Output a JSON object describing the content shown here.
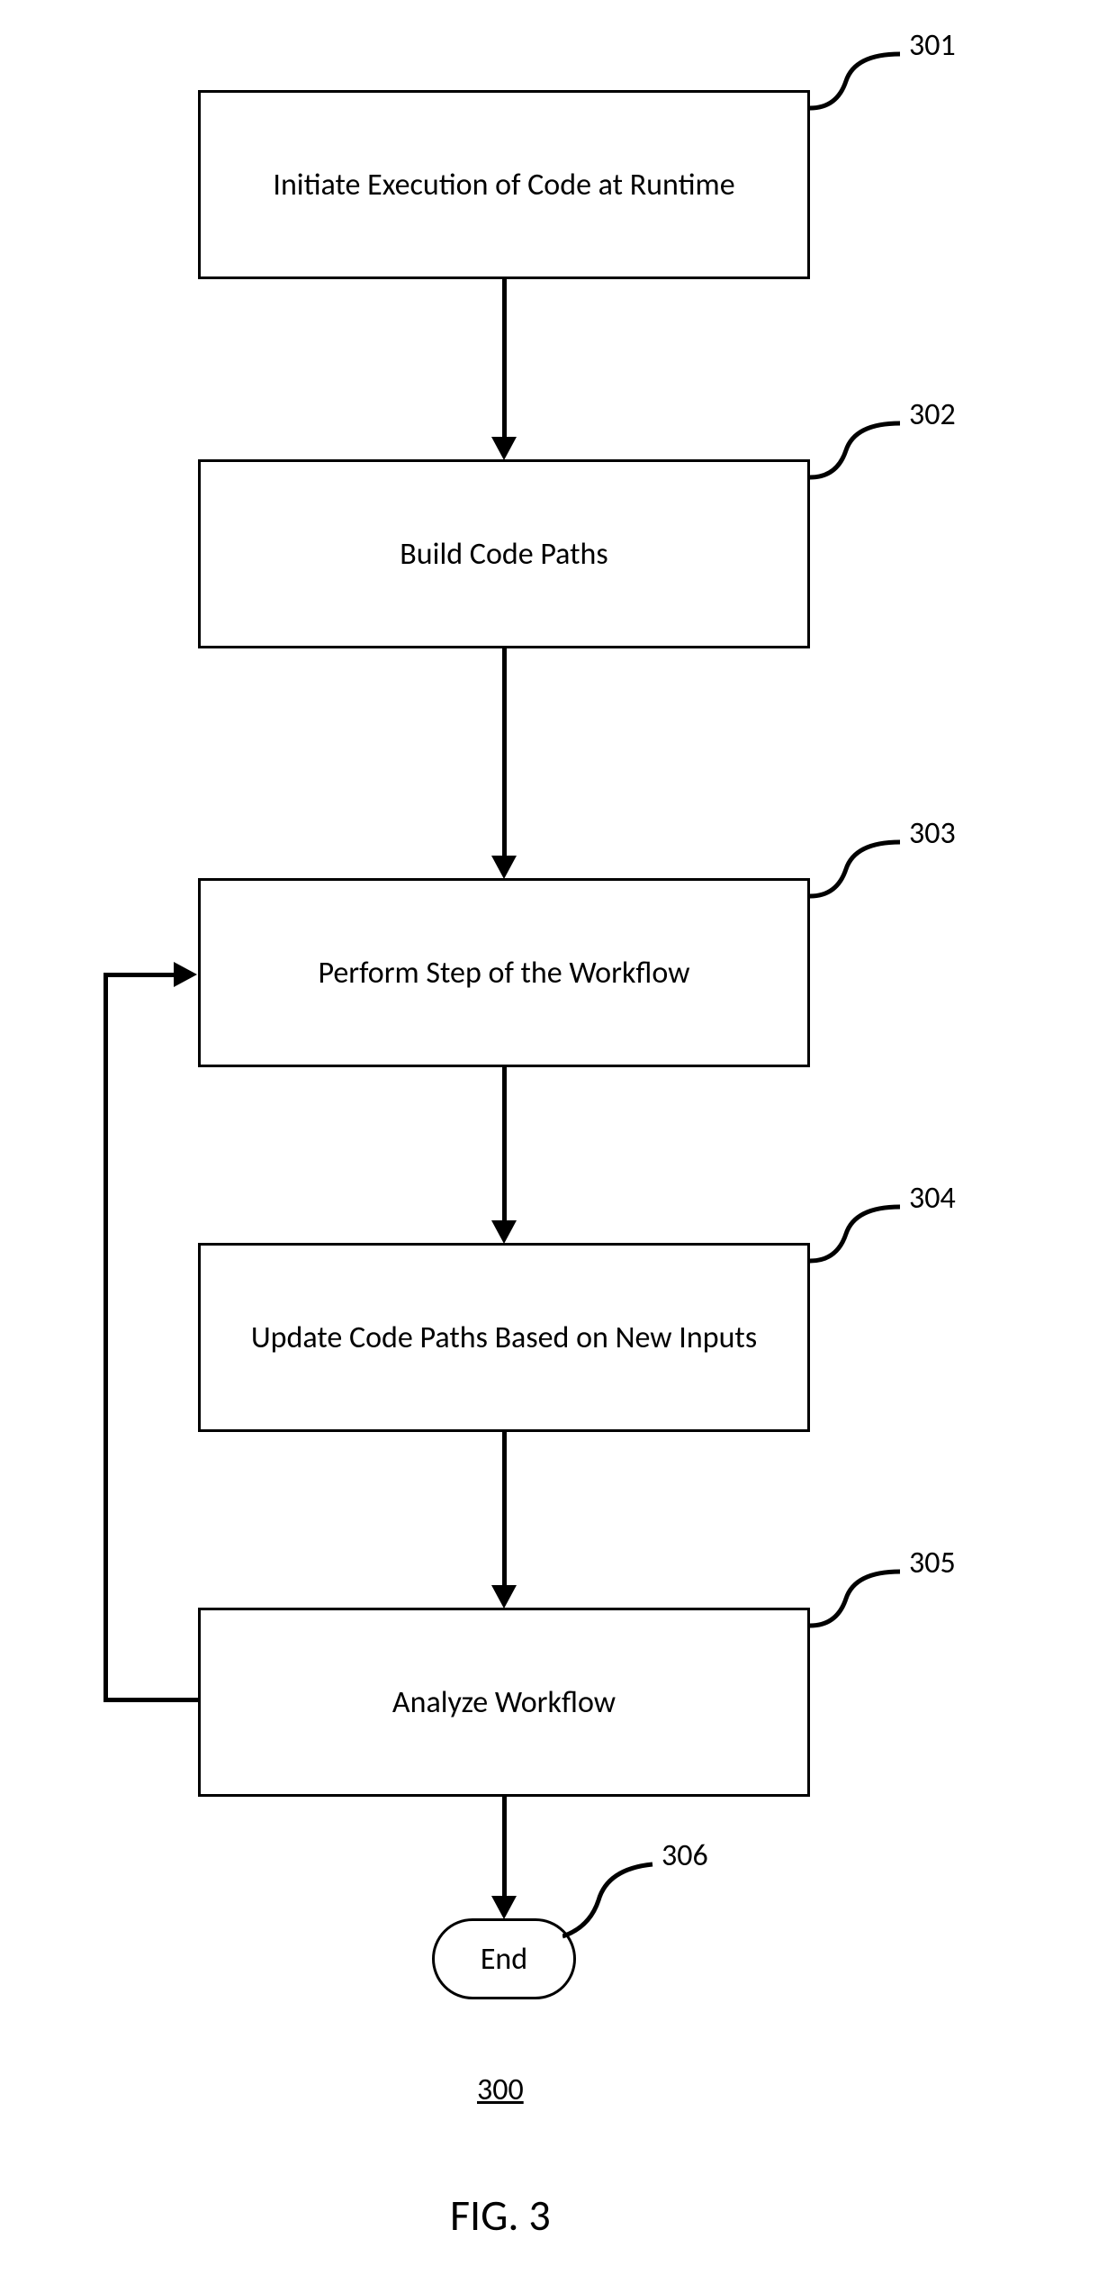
{
  "steps": {
    "s1": {
      "label": "Initiate Execution of Code at Runtime",
      "ref": "301"
    },
    "s2": {
      "label": "Build Code Paths",
      "ref": "302"
    },
    "s3": {
      "label": "Perform Step of the Workflow",
      "ref": "303"
    },
    "s4": {
      "label": "Update Code Paths Based on  New Inputs",
      "ref": "304"
    },
    "s5": {
      "label": "Analyze Workflow",
      "ref": "305"
    },
    "end": {
      "label": "End",
      "ref": "306"
    }
  },
  "figure_number": "300",
  "figure_caption": "FIG. 3"
}
